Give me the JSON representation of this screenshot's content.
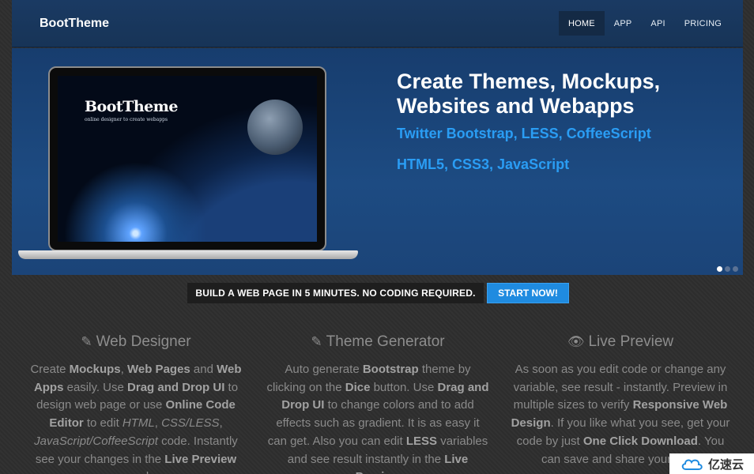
{
  "navbar": {
    "brand": "BootTheme",
    "items": [
      {
        "label": "HOME",
        "active": true
      },
      {
        "label": "APP"
      },
      {
        "label": "API"
      },
      {
        "label": "PRICING"
      }
    ]
  },
  "hero": {
    "screen_title": "BootTheme",
    "screen_subtitle": "online designer to create webapps",
    "title_line1": "Create Themes, Mockups,",
    "title_line2": "Websites and Webapps",
    "sub1": "Twitter Bootstrap, LESS, CoffeeScript",
    "sub2": "HTML5, CSS3, JavaScript",
    "slides": 3,
    "active_slide": 1
  },
  "cta": {
    "text": "BUILD A WEB PAGE IN 5 MINUTES. NO CODING REQUIRED.",
    "button": "START NOW!"
  },
  "features": [
    {
      "title": "Web Designer",
      "icon": "edit-icon"
    },
    {
      "title": "Theme Generator",
      "icon": "edit-icon"
    },
    {
      "title": "Live Preview",
      "icon": "eye-icon"
    }
  ],
  "watermark": {
    "text": "亿速云"
  },
  "colors": {
    "accent": "#1f8be0",
    "hero_text": "#2a9df4",
    "navbar": "#1a3a63"
  }
}
